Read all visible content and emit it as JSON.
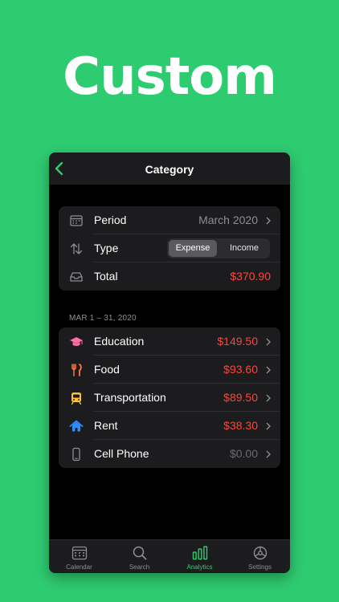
{
  "headline": "Custom",
  "nav": {
    "title": "Category",
    "back_icon": "chevron-left-icon"
  },
  "summary": {
    "period": {
      "label": "Period",
      "value": "March 2020",
      "icon": "calendar-icon"
    },
    "type": {
      "label": "Type",
      "options": [
        "Expense",
        "Income"
      ],
      "selected": "Expense",
      "icon": "sort-arrows-icon"
    },
    "total": {
      "label": "Total",
      "value": "$370.90",
      "icon": "tray-icon"
    }
  },
  "section_header": "MAR 1 – 31, 2020",
  "categories": [
    {
      "label": "Education",
      "value": "$149.50",
      "icon": "graduation-cap-icon",
      "color": "#ff6fa3"
    },
    {
      "label": "Food",
      "value": "$93.60",
      "icon": "fork-knife-icon",
      "color": "#ff7a3d"
    },
    {
      "label": "Transportation",
      "value": "$89.50",
      "icon": "train-icon",
      "color": "#ffc12e"
    },
    {
      "label": "Rent",
      "value": "$38.30",
      "icon": "house-icon",
      "color": "#2f8cff"
    },
    {
      "label": "Cell Phone",
      "value": "$0.00",
      "icon": "phone-icon",
      "color": "#8e8e93"
    }
  ],
  "tabs": [
    {
      "label": "Calendar",
      "icon": "calendar-icon",
      "active": false
    },
    {
      "label": "Search",
      "icon": "magnifier-icon",
      "active": false
    },
    {
      "label": "Analytics",
      "icon": "bar-chart-icon",
      "active": true
    },
    {
      "label": "Settings",
      "icon": "gear-icon",
      "active": false
    }
  ],
  "colors": {
    "background": "#2ecc71",
    "accent": "#2ecc71",
    "expense_red": "#ff453a",
    "card": "#1c1c1e"
  }
}
